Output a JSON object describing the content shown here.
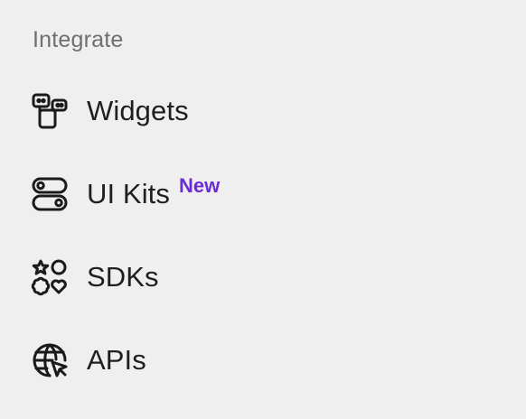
{
  "section": {
    "title": "Integrate"
  },
  "items": [
    {
      "label": "Widgets",
      "icon": "widgets-icon"
    },
    {
      "label": "UI Kits",
      "icon": "toggles-icon",
      "badge": "New"
    },
    {
      "label": "SDKs",
      "icon": "shapes-icon"
    },
    {
      "label": "APIs",
      "icon": "globe-cursor-icon"
    }
  ],
  "colors": {
    "background": "#efefef",
    "text": "#1f1f22",
    "muted": "#6e6e73",
    "badge": "#6b2bd6"
  }
}
